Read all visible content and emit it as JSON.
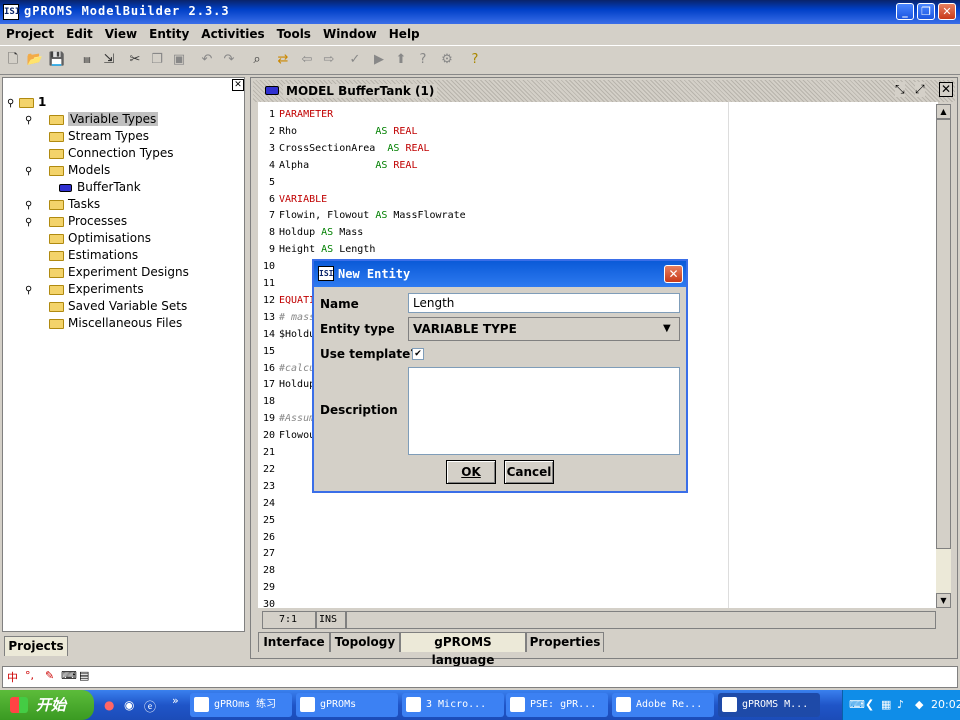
{
  "window": {
    "title": "gPROMS ModelBuilder 2.3.3",
    "icon_text": "ISI",
    "controls": {
      "minimize": "_",
      "maximize": "❐",
      "close": "✕"
    }
  },
  "menu": [
    "Project",
    "Edit",
    "View",
    "Entity",
    "Activities",
    "Tools",
    "Window",
    "Help"
  ],
  "toolbar_icons": [
    "new-icon",
    "open-icon",
    "save-icon",
    "pml-icon",
    "cut-icon",
    "copy-icon",
    "paste-icon",
    "undo-icon",
    "redo-icon",
    "find-icon",
    "replace-icon",
    "back-icon",
    "forward-icon",
    "check-icon",
    "run-icon",
    "up-icon",
    "help-query-icon",
    "run-debug-icon",
    "help-icon"
  ],
  "tree": {
    "root": "1",
    "items": [
      {
        "label": "Variable Types",
        "type": "folder",
        "expander": "key",
        "selected": true
      },
      {
        "label": "Stream Types",
        "type": "folder"
      },
      {
        "label": "Connection Types",
        "type": "folder"
      },
      {
        "label": "Models",
        "type": "folder",
        "expander": "open"
      },
      {
        "label": "BufferTank",
        "type": "model"
      },
      {
        "label": "Tasks",
        "type": "folder",
        "expander": "key"
      },
      {
        "label": "Processes",
        "type": "folder",
        "expander": "key"
      },
      {
        "label": "Optimisations",
        "type": "folder"
      },
      {
        "label": "Estimations",
        "type": "folder"
      },
      {
        "label": "Experiment Designs",
        "type": "folder"
      },
      {
        "label": "Experiments",
        "type": "folder",
        "expander": "key"
      },
      {
        "label": "Saved Variable Sets",
        "type": "folder"
      },
      {
        "label": "Miscellaneous Files",
        "type": "folder"
      }
    ]
  },
  "left_tab": "Projects",
  "editor": {
    "title": "MODEL BufferTank (1)",
    "lines": [
      {
        "n": "1",
        "parts": [
          {
            "t": "PARAMETER",
            "c": "kw"
          }
        ]
      },
      {
        "n": "2",
        "parts": [
          {
            "t": "Rho             ",
            "c": ""
          },
          {
            "t": "AS",
            "c": "as"
          },
          {
            "t": " REAL",
            "c": "kw"
          }
        ]
      },
      {
        "n": "3",
        "parts": [
          {
            "t": "CrossSectionArea  ",
            "c": ""
          },
          {
            "t": "AS",
            "c": "as"
          },
          {
            "t": " REAL",
            "c": "kw"
          }
        ]
      },
      {
        "n": "4",
        "parts": [
          {
            "t": "Alpha           ",
            "c": ""
          },
          {
            "t": "AS",
            "c": "as"
          },
          {
            "t": " REAL",
            "c": "kw"
          }
        ]
      },
      {
        "n": "5",
        "parts": []
      },
      {
        "n": "6",
        "parts": [
          {
            "t": "VARIABLE",
            "c": "kw"
          }
        ]
      },
      {
        "n": "7",
        "parts": [
          {
            "t": "Flowin, Flowout ",
            "c": ""
          },
          {
            "t": "AS",
            "c": "as"
          },
          {
            "t": " MassFlowrate",
            "c": ""
          }
        ]
      },
      {
        "n": "8",
        "parts": [
          {
            "t": "Holdup ",
            "c": ""
          },
          {
            "t": "AS",
            "c": "as"
          },
          {
            "t": " Mass",
            "c": ""
          }
        ]
      },
      {
        "n": "9",
        "parts": [
          {
            "t": "Height ",
            "c": ""
          },
          {
            "t": "AS",
            "c": "as"
          },
          {
            "t": " Length",
            "c": ""
          }
        ]
      },
      {
        "n": "10",
        "parts": []
      },
      {
        "n": "11",
        "parts": []
      },
      {
        "n": "12",
        "parts": [
          {
            "t": "EQUATI",
            "c": "kw"
          }
        ]
      },
      {
        "n": "13",
        "parts": [
          {
            "t": "# mass",
            "c": "cm"
          }
        ]
      },
      {
        "n": "14",
        "parts": [
          {
            "t": "$Holdu",
            "c": ""
          }
        ]
      },
      {
        "n": "15",
        "parts": []
      },
      {
        "n": "16",
        "parts": [
          {
            "t": "#calcu",
            "c": "cm"
          }
        ]
      },
      {
        "n": "17",
        "parts": [
          {
            "t": "Holdup",
            "c": ""
          }
        ]
      },
      {
        "n": "18",
        "parts": []
      },
      {
        "n": "19",
        "parts": [
          {
            "t": "#Assum",
            "c": "cm"
          }
        ]
      },
      {
        "n": "20",
        "parts": [
          {
            "t": "Flowou",
            "c": ""
          }
        ]
      },
      {
        "n": "21",
        "parts": []
      },
      {
        "n": "22",
        "parts": []
      },
      {
        "n": "23",
        "parts": []
      },
      {
        "n": "24",
        "parts": []
      },
      {
        "n": "25",
        "parts": []
      },
      {
        "n": "26",
        "parts": []
      },
      {
        "n": "27",
        "parts": []
      },
      {
        "n": "28",
        "parts": []
      },
      {
        "n": "29",
        "parts": []
      },
      {
        "n": "30",
        "parts": []
      }
    ],
    "status_position": "7:1",
    "status_mode": "INS",
    "tabs": [
      "Interface",
      "Topology",
      "gPROMS language",
      "Properties"
    ],
    "active_tab": "gPROMS language"
  },
  "dialog": {
    "title": "New Entity",
    "name_label": "Name",
    "name_value": "Length",
    "entity_type_label": "Entity type",
    "entity_type_value": "VARIABLE TYPE",
    "template_label": "Use template?",
    "template_checked": "✔",
    "description_label": "Description",
    "ok_label": "OK",
    "cancel_label": "Cancel"
  },
  "taskbar": {
    "start": "开始",
    "tasks": [
      {
        "label": "gPROms 练习",
        "icon": "folder-icon"
      },
      {
        "label": "gPROMs",
        "icon": "ppt-icon"
      },
      {
        "label": "3 Micro...",
        "icon": "word-icon"
      },
      {
        "label": "PSE: gPR...",
        "icon": "opera-icon"
      },
      {
        "label": "Adobe Re...",
        "icon": "pdf-icon"
      },
      {
        "label": "gPROMS M...",
        "icon": "gproms-icon"
      }
    ],
    "clock": "20:02"
  }
}
